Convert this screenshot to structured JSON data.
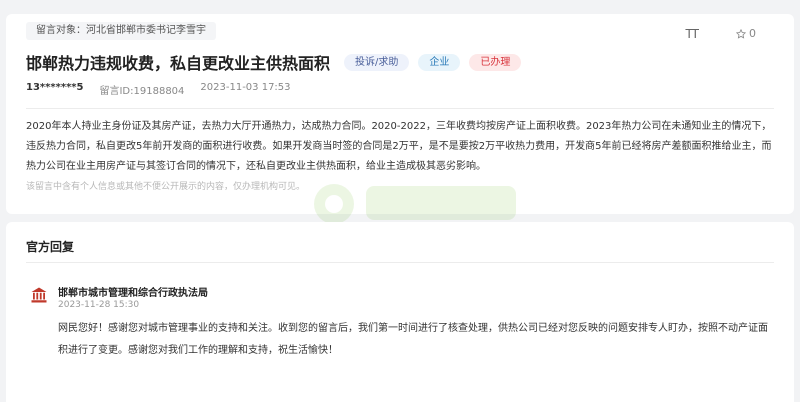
{
  "message": {
    "target_label": "留言对象：河北省邯郸市委书记李雪宇",
    "title": "邯郸热力违规收费，私自更改业主供热面积",
    "tags": [
      "投诉/求助",
      "企业",
      "已办理"
    ],
    "user": "13*******5",
    "message_id": "留言ID:19188804",
    "time": "2023-11-03 17:53",
    "font_tool": "TT",
    "like_count": "0",
    "content": "2020年本人持业主身份证及其房产证，去热力大厅开通热力，达成热力合同。2020-2022，三年收费均按房产证上面积收费。2023年热力公司在未通知业主的情况下，违反热力合同，私自更改5年前开发商的面积进行收费。如果开发商当时签的合同是2万平，是不是要按2万平收热力费用，开发商5年前已经将房产差额面积推给业主，而热力公司在业主用房产证与其签订合同的情况下，还私自更改业主供热面积，给业主造成极其恶劣影响。",
    "disclaimer": "该留言中含有个人信息或其他不便公开展示的内容，仅办理机构可见。"
  },
  "reply": {
    "header": "官方回复",
    "department": "邯郸市城市管理和综合行政执法局",
    "date": "2023-11-28 15:30",
    "content": "网民您好！感谢您对城市管理事业的支持和关注。收到您的留言后，我们第一时间进行了核查处理，供热公司已经对您反映的问题安排专人盯办，按照不动产证面积进行了变更。感谢您对我们工作的理解和支持，祝生活愉快！"
  },
  "colors": {
    "tag_red": "#d9363e",
    "tag_blue": "#4a5f9a",
    "tag_teal": "#2a7ab8",
    "dept_icon": "#c0392b"
  },
  "icons": {
    "like": "star-icon",
    "font": "font-size-icon",
    "department": "government-building-icon"
  }
}
